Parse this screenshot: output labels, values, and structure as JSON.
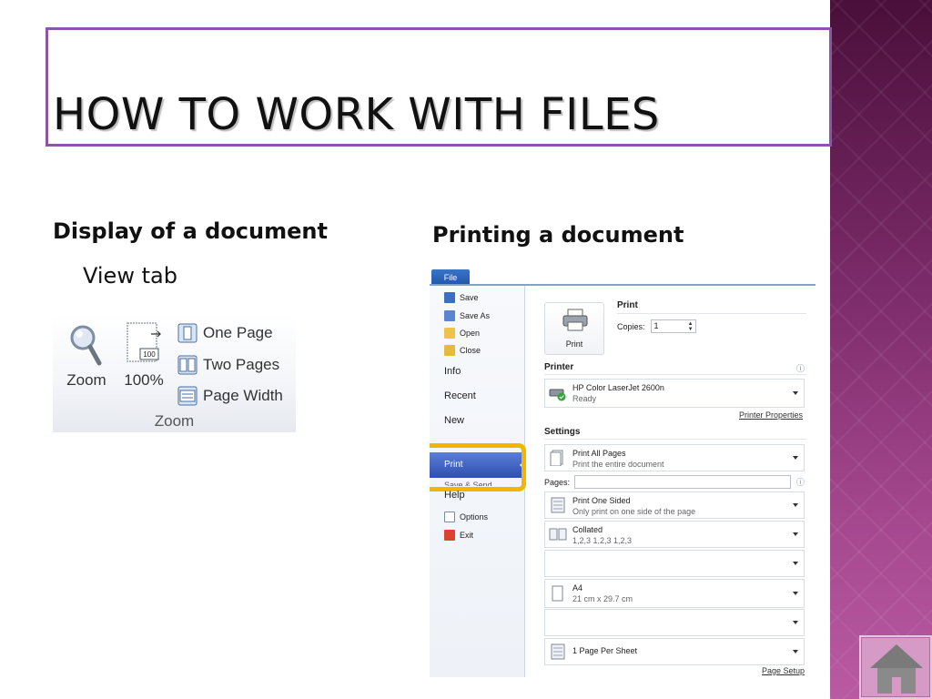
{
  "slide": {
    "title": "HOW TO WORK WITH FILES",
    "left_heading": "Display of a document",
    "left_subheading": "View tab",
    "right_heading": "Printing a document"
  },
  "zoom_group": {
    "zoom_label": "Zoom",
    "hundred_label": "100%",
    "hundred_icon_text": "100",
    "one_page": "One Page",
    "two_pages": "Two Pages",
    "page_width": "Page Width",
    "group_label": "Zoom"
  },
  "backstage": {
    "file_tab": "File",
    "menu": {
      "save": "Save",
      "save_as": "Save As",
      "open": "Open",
      "close": "Close",
      "info": "Info",
      "recent": "Recent",
      "new": "New",
      "print": "Print",
      "save_send": "Save & Send",
      "help": "Help",
      "options": "Options",
      "exit": "Exit"
    },
    "print_panel": {
      "print_button": "Print",
      "print_title": "Print",
      "copies_label": "Copies:",
      "copies_value": "1",
      "printer_section": "Printer",
      "printer_name": "HP Color LaserJet 2600n",
      "printer_status": "Ready",
      "printer_properties": "Printer Properties",
      "settings_section": "Settings",
      "print_all_pages": "Print All Pages",
      "print_all_pages_desc": "Print the entire document",
      "pages_label": "Pages:",
      "one_sided": "Print One Sided",
      "one_sided_desc": "Only print on one side of the page",
      "collated": "Collated",
      "collated_desc": "1,2,3   1,2,3   1,2,3",
      "paper_size": "A4",
      "paper_size_desc": "21 cm x 29.7 cm",
      "pages_per_sheet": "1 Page Per Sheet",
      "page_setup": "Page Setup",
      "info_icon": "ⓘ"
    }
  },
  "colors": {
    "title_border": "#8c56a6",
    "highlight": "#f4b400",
    "print_selected": "#2f4fb0",
    "band": "#7a2a68"
  }
}
